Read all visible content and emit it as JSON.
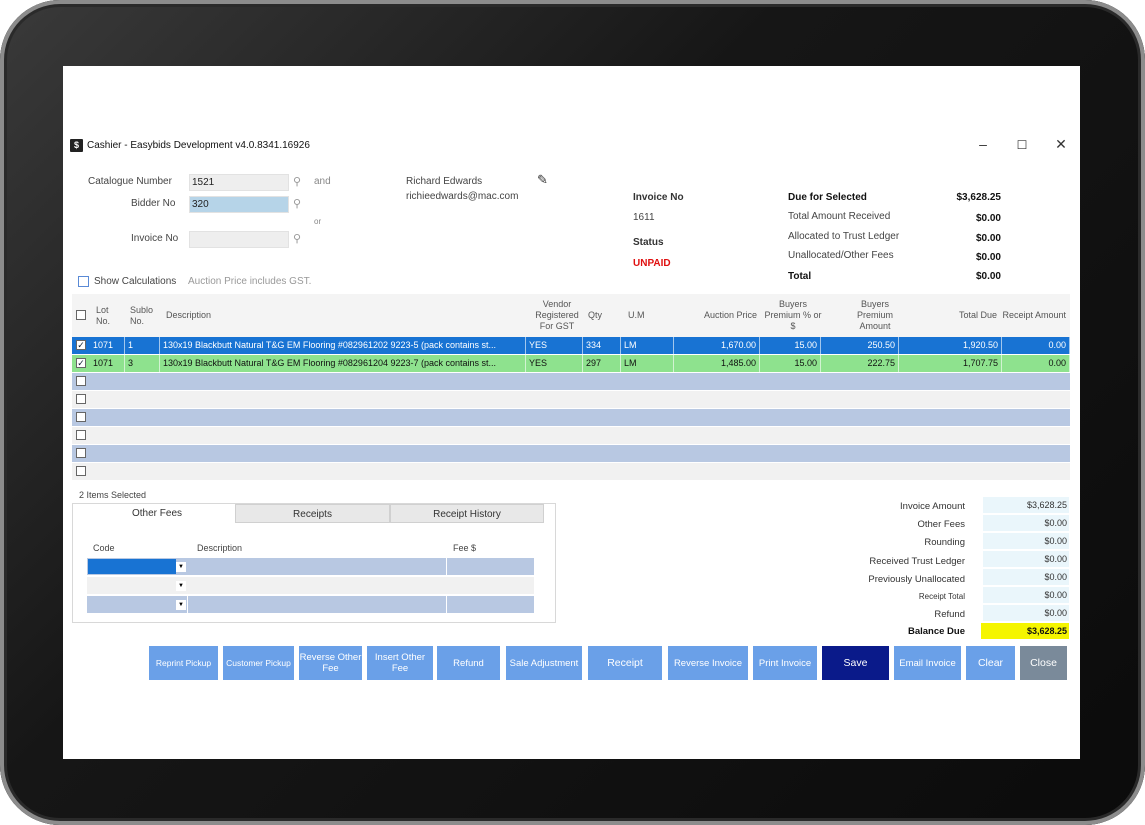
{
  "window": {
    "title": "Cashier - Easybids Development v4.0.8341.16926",
    "icon": "$"
  },
  "search": {
    "catalogue_label": "Catalogue Number",
    "catalogue_value": "1521",
    "and_label": "and",
    "bidder_label": "Bidder No",
    "bidder_value": "320",
    "or_label": "or",
    "invoice_label": "Invoice No",
    "invoice_value": ""
  },
  "customer": {
    "name": "Richard Edwards",
    "email": "richieedwards@mac.com"
  },
  "invoice": {
    "no_label": "Invoice No",
    "no_value": "1611",
    "status_label": "Status",
    "status_value": "UNPAID"
  },
  "totals": {
    "due_selected_label": "Due for Selected",
    "due_selected_value": "$3,628.25",
    "received_label": "Total Amount Received",
    "received_value": "$0.00",
    "allocated_label": "Allocated to Trust Ledger",
    "allocated_value": "$0.00",
    "unallocated_label": "Unallocated/Other Fees",
    "unallocated_value": "$0.00",
    "total_label": "Total",
    "total_value": "$0.00"
  },
  "options": {
    "show_calc_label": "Show Calculations",
    "gst_note": "Auction Price includes GST."
  },
  "grid": {
    "headers": {
      "lot": "Lot No.",
      "sublot": "Sublo No.",
      "description": "Description",
      "vendor_gst": "Vendor Registered For GST",
      "qty": "Qty",
      "um": "U.M",
      "auction_price": "Auction Price",
      "bp_pct": "Buyers Premium % or $",
      "bp_amt": "Buyers Premium Amount",
      "total_due": "Total Due",
      "receipt_amt": "Receipt Amount"
    },
    "rows": [
      {
        "checked": true,
        "lot": "1071",
        "sublot": "1",
        "description": "130x19 Blackbutt Natural T&G EM Flooring #082961202 9223-5 (pack contains st...",
        "vendor_gst": "YES",
        "qty": "334",
        "um": "LM",
        "auction_price": "1,670.00",
        "bp_pct": "15.00",
        "bp_amt": "250.50",
        "total_due": "1,920.50",
        "receipt_amt": "0.00"
      },
      {
        "checked": true,
        "lot": "1071",
        "sublot": "3",
        "description": "130x19 Blackbutt Natural T&G EM Flooring #082961204 9223-7 (pack contains st...",
        "vendor_gst": "YES",
        "qty": "297",
        "um": "LM",
        "auction_price": "1,485.00",
        "bp_pct": "15.00",
        "bp_amt": "222.75",
        "total_due": "1,707.75",
        "receipt_amt": "0.00"
      }
    ],
    "selected_count": "2 Items Selected"
  },
  "fees": {
    "tabs": [
      "Other Fees",
      "Receipts",
      "Receipt History"
    ],
    "col_code": "Code",
    "col_description": "Description",
    "col_fee": "Fee $"
  },
  "summary": {
    "invoice_amount_label": "Invoice Amount",
    "invoice_amount_value": "$3,628.25",
    "other_fees_label": "Other Fees",
    "other_fees_value": "$0.00",
    "rounding_label": "Rounding",
    "rounding_value": "$0.00",
    "received_trust_label": "Received Trust Ledger",
    "received_trust_value": "$0.00",
    "prev_unalloc_label": "Previously Unallocated",
    "prev_unalloc_value": "$0.00",
    "receipt_total_label": "Receipt Total",
    "receipt_total_value": "$0.00",
    "refund_label": "Refund",
    "refund_value": "$0.00",
    "balance_label": "Balance Due",
    "balance_value": "$3,628.25"
  },
  "buttons": {
    "reprint_pickup": "Reprint Pickup",
    "customer_pickup": "Customer Pickup",
    "reverse_other_fee": "Reverse Other Fee",
    "insert_other_fee": "Insert Other Fee",
    "refund": "Refund",
    "sale_adjustment": "Sale Adjustment",
    "receipt": "Receipt",
    "reverse_invoice": "Reverse Invoice",
    "print_invoice": "Print Invoice",
    "save": "Save",
    "email_invoice": "Email Invoice",
    "clear": "Clear",
    "close": "Close"
  },
  "colors": {
    "selected_row": "#1873d3",
    "green_row": "#8ee28e",
    "band_row": "#b8c8e2",
    "button": "#6aa0e8",
    "save_button": "#0a1a8a",
    "close_button": "#7a8a9a",
    "balance_highlight": "#f5f500",
    "status_red": "#e01010"
  }
}
